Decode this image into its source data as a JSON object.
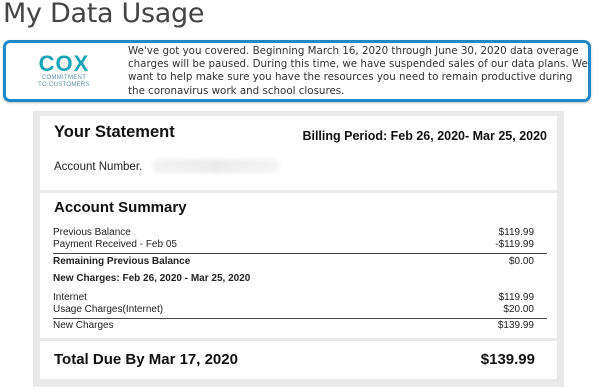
{
  "page": {
    "title": "My Data Usage"
  },
  "notice": {
    "logo_word": "cox",
    "logo_tagline_1": "Commitment",
    "logo_tagline_2": "to customers",
    "text": "We've got you covered. Beginning March 16, 2020 through June 30, 2020 data overage charges will be paused. During this time, we have suspended sales of our data plans. We want to help make sure you have the resources you need to remain productive during the coronavirus work and school closures.",
    "border_color": "#1e88c8",
    "logo_color": "#17a3b8"
  },
  "statement": {
    "title": "Your Statement",
    "billing_period": "Billing Period: Feb 26, 2020- Mar 25, 2020",
    "account_label": "Account Number.",
    "summary": {
      "title": "Account Summary",
      "previous_balance": {
        "label": "Previous Balance",
        "value": "$119.99"
      },
      "payment_received": {
        "label": "Payment Received - Feb 05",
        "value": "-$119.99"
      },
      "remaining_previous": {
        "label": "Remaining Previous Balance",
        "value": "$0.00"
      },
      "new_charges_header": "New Charges: Feb 26, 2020 - Mar 25, 2020",
      "internet": {
        "label": "Internet",
        "value": "$119.99"
      },
      "usage_charges": {
        "label": "Usage Charges(Internet)",
        "value": "$20.00"
      },
      "new_charges": {
        "label": "New Charges",
        "value": "$139.99"
      }
    },
    "total": {
      "label": "Total Due By Mar 17, 2020",
      "value": "$139.99"
    }
  }
}
